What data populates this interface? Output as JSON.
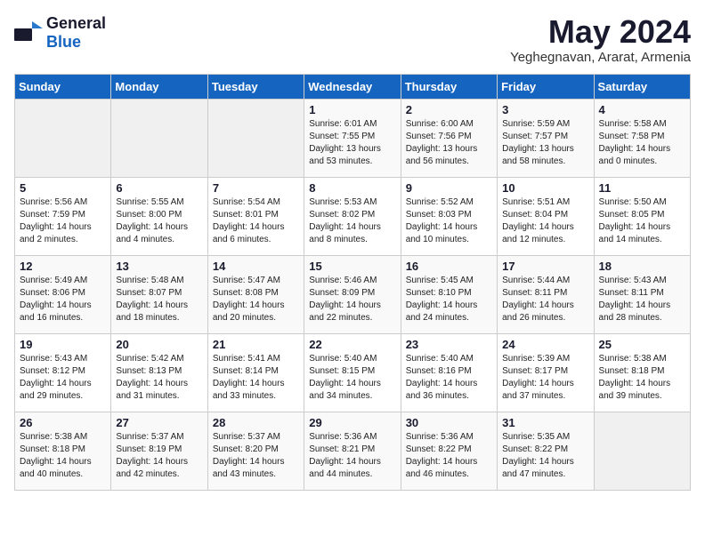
{
  "header": {
    "logo_general": "General",
    "logo_blue": "Blue",
    "title": "May 2024",
    "location": "Yeghegnavan, Ararat, Armenia"
  },
  "columns": [
    "Sunday",
    "Monday",
    "Tuesday",
    "Wednesday",
    "Thursday",
    "Friday",
    "Saturday"
  ],
  "weeks": [
    {
      "days": [
        {
          "number": "",
          "empty": true
        },
        {
          "number": "",
          "empty": true
        },
        {
          "number": "",
          "empty": true
        },
        {
          "number": "1",
          "sunrise": "Sunrise: 6:01 AM",
          "sunset": "Sunset: 7:55 PM",
          "daylight": "Daylight: 13 hours and 53 minutes."
        },
        {
          "number": "2",
          "sunrise": "Sunrise: 6:00 AM",
          "sunset": "Sunset: 7:56 PM",
          "daylight": "Daylight: 13 hours and 56 minutes."
        },
        {
          "number": "3",
          "sunrise": "Sunrise: 5:59 AM",
          "sunset": "Sunset: 7:57 PM",
          "daylight": "Daylight: 13 hours and 58 minutes."
        },
        {
          "number": "4",
          "sunrise": "Sunrise: 5:58 AM",
          "sunset": "Sunset: 7:58 PM",
          "daylight": "Daylight: 14 hours and 0 minutes."
        }
      ]
    },
    {
      "days": [
        {
          "number": "5",
          "sunrise": "Sunrise: 5:56 AM",
          "sunset": "Sunset: 7:59 PM",
          "daylight": "Daylight: 14 hours and 2 minutes."
        },
        {
          "number": "6",
          "sunrise": "Sunrise: 5:55 AM",
          "sunset": "Sunset: 8:00 PM",
          "daylight": "Daylight: 14 hours and 4 minutes."
        },
        {
          "number": "7",
          "sunrise": "Sunrise: 5:54 AM",
          "sunset": "Sunset: 8:01 PM",
          "daylight": "Daylight: 14 hours and 6 minutes."
        },
        {
          "number": "8",
          "sunrise": "Sunrise: 5:53 AM",
          "sunset": "Sunset: 8:02 PM",
          "daylight": "Daylight: 14 hours and 8 minutes."
        },
        {
          "number": "9",
          "sunrise": "Sunrise: 5:52 AM",
          "sunset": "Sunset: 8:03 PM",
          "daylight": "Daylight: 14 hours and 10 minutes."
        },
        {
          "number": "10",
          "sunrise": "Sunrise: 5:51 AM",
          "sunset": "Sunset: 8:04 PM",
          "daylight": "Daylight: 14 hours and 12 minutes."
        },
        {
          "number": "11",
          "sunrise": "Sunrise: 5:50 AM",
          "sunset": "Sunset: 8:05 PM",
          "daylight": "Daylight: 14 hours and 14 minutes."
        }
      ]
    },
    {
      "days": [
        {
          "number": "12",
          "sunrise": "Sunrise: 5:49 AM",
          "sunset": "Sunset: 8:06 PM",
          "daylight": "Daylight: 14 hours and 16 minutes."
        },
        {
          "number": "13",
          "sunrise": "Sunrise: 5:48 AM",
          "sunset": "Sunset: 8:07 PM",
          "daylight": "Daylight: 14 hours and 18 minutes."
        },
        {
          "number": "14",
          "sunrise": "Sunrise: 5:47 AM",
          "sunset": "Sunset: 8:08 PM",
          "daylight": "Daylight: 14 hours and 20 minutes."
        },
        {
          "number": "15",
          "sunrise": "Sunrise: 5:46 AM",
          "sunset": "Sunset: 8:09 PM",
          "daylight": "Daylight: 14 hours and 22 minutes."
        },
        {
          "number": "16",
          "sunrise": "Sunrise: 5:45 AM",
          "sunset": "Sunset: 8:10 PM",
          "daylight": "Daylight: 14 hours and 24 minutes."
        },
        {
          "number": "17",
          "sunrise": "Sunrise: 5:44 AM",
          "sunset": "Sunset: 8:11 PM",
          "daylight": "Daylight: 14 hours and 26 minutes."
        },
        {
          "number": "18",
          "sunrise": "Sunrise: 5:43 AM",
          "sunset": "Sunset: 8:11 PM",
          "daylight": "Daylight: 14 hours and 28 minutes."
        }
      ]
    },
    {
      "days": [
        {
          "number": "19",
          "sunrise": "Sunrise: 5:43 AM",
          "sunset": "Sunset: 8:12 PM",
          "daylight": "Daylight: 14 hours and 29 minutes."
        },
        {
          "number": "20",
          "sunrise": "Sunrise: 5:42 AM",
          "sunset": "Sunset: 8:13 PM",
          "daylight": "Daylight: 14 hours and 31 minutes."
        },
        {
          "number": "21",
          "sunrise": "Sunrise: 5:41 AM",
          "sunset": "Sunset: 8:14 PM",
          "daylight": "Daylight: 14 hours and 33 minutes."
        },
        {
          "number": "22",
          "sunrise": "Sunrise: 5:40 AM",
          "sunset": "Sunset: 8:15 PM",
          "daylight": "Daylight: 14 hours and 34 minutes."
        },
        {
          "number": "23",
          "sunrise": "Sunrise: 5:40 AM",
          "sunset": "Sunset: 8:16 PM",
          "daylight": "Daylight: 14 hours and 36 minutes."
        },
        {
          "number": "24",
          "sunrise": "Sunrise: 5:39 AM",
          "sunset": "Sunset: 8:17 PM",
          "daylight": "Daylight: 14 hours and 37 minutes."
        },
        {
          "number": "25",
          "sunrise": "Sunrise: 5:38 AM",
          "sunset": "Sunset: 8:18 PM",
          "daylight": "Daylight: 14 hours and 39 minutes."
        }
      ]
    },
    {
      "days": [
        {
          "number": "26",
          "sunrise": "Sunrise: 5:38 AM",
          "sunset": "Sunset: 8:18 PM",
          "daylight": "Daylight: 14 hours and 40 minutes."
        },
        {
          "number": "27",
          "sunrise": "Sunrise: 5:37 AM",
          "sunset": "Sunset: 8:19 PM",
          "daylight": "Daylight: 14 hours and 42 minutes."
        },
        {
          "number": "28",
          "sunrise": "Sunrise: 5:37 AM",
          "sunset": "Sunset: 8:20 PM",
          "daylight": "Daylight: 14 hours and 43 minutes."
        },
        {
          "number": "29",
          "sunrise": "Sunrise: 5:36 AM",
          "sunset": "Sunset: 8:21 PM",
          "daylight": "Daylight: 14 hours and 44 minutes."
        },
        {
          "number": "30",
          "sunrise": "Sunrise: 5:36 AM",
          "sunset": "Sunset: 8:22 PM",
          "daylight": "Daylight: 14 hours and 46 minutes."
        },
        {
          "number": "31",
          "sunrise": "Sunrise: 5:35 AM",
          "sunset": "Sunset: 8:22 PM",
          "daylight": "Daylight: 14 hours and 47 minutes."
        },
        {
          "number": "",
          "empty": true
        }
      ]
    }
  ]
}
